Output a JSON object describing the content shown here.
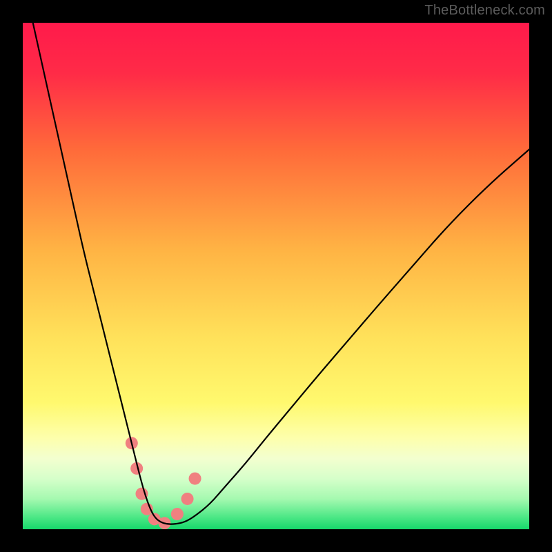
{
  "watermark": "TheBottleneck.com",
  "chart_data": {
    "type": "line",
    "title": "",
    "xlabel": "",
    "ylabel": "",
    "xlim": [
      0,
      100
    ],
    "ylim": [
      0,
      100
    ],
    "background_gradient": {
      "stops": [
        {
          "offset": 0.0,
          "color": "#ff1a4b"
        },
        {
          "offset": 0.1,
          "color": "#ff2b47"
        },
        {
          "offset": 0.25,
          "color": "#ff6a3a"
        },
        {
          "offset": 0.45,
          "color": "#ffb444"
        },
        {
          "offset": 0.62,
          "color": "#ffe15a"
        },
        {
          "offset": 0.75,
          "color": "#fff96e"
        },
        {
          "offset": 0.82,
          "color": "#fdffac"
        },
        {
          "offset": 0.86,
          "color": "#f3ffcf"
        },
        {
          "offset": 0.9,
          "color": "#d6ffca"
        },
        {
          "offset": 0.94,
          "color": "#a5f9b0"
        },
        {
          "offset": 0.975,
          "color": "#4fe887"
        },
        {
          "offset": 1.0,
          "color": "#16d86b"
        }
      ]
    },
    "series": [
      {
        "name": "bottleneck-curve",
        "color": "#000000",
        "width": 2.2,
        "x": [
          2,
          4,
          6,
          8,
          10,
          12,
          14,
          16,
          18,
          20,
          21,
          22,
          23,
          23.8,
          24.6,
          25.4,
          26.2,
          27.2,
          28.5,
          30,
          32,
          34,
          37,
          40,
          44,
          48,
          53,
          58,
          64,
          70,
          77,
          84,
          92,
          100
        ],
        "y": [
          100,
          91,
          82,
          73,
          64,
          55,
          47,
          39,
          31,
          23,
          19,
          15,
          11,
          8,
          5.5,
          3.5,
          2.2,
          1.4,
          1.0,
          1.0,
          1.4,
          2.6,
          5.0,
          8.5,
          13,
          18,
          24,
          30,
          37,
          44,
          52,
          60,
          68,
          75
        ]
      }
    ],
    "markers": {
      "name": "highlight-dots",
      "color": "#f08080",
      "radius": 9,
      "points": [
        {
          "x": 21.5,
          "y": 17
        },
        {
          "x": 22.5,
          "y": 12
        },
        {
          "x": 23.5,
          "y": 7
        },
        {
          "x": 24.5,
          "y": 4
        },
        {
          "x": 26.0,
          "y": 2
        },
        {
          "x": 28.0,
          "y": 1.2
        },
        {
          "x": 30.5,
          "y": 3
        },
        {
          "x": 32.5,
          "y": 6
        },
        {
          "x": 34.0,
          "y": 10
        }
      ]
    }
  }
}
